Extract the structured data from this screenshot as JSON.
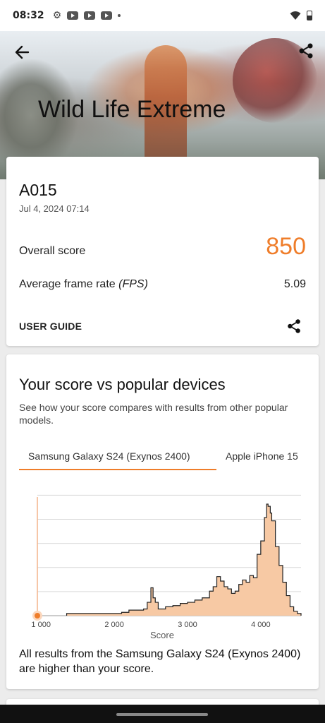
{
  "status_bar": {
    "time": "08:32"
  },
  "header": {
    "title": "Wild Life Extreme"
  },
  "result": {
    "device": "A015",
    "date": "Jul 4, 2024 07:14",
    "overall_label": "Overall score",
    "overall_value": "850",
    "fps_label": "Average frame rate",
    "fps_unit": "(FPS)",
    "fps_value": "5.09",
    "guide_label": "USER GUIDE"
  },
  "comparison": {
    "title": "Your score vs popular devices",
    "description": "See how your score compares with results from other popular models.",
    "tabs": [
      "Samsung Galaxy S24 (Exynos 2400)",
      "Apple iPhone 15"
    ],
    "active_tab": 0,
    "footnote": "All results from the Samsung Galaxy S24 (Exynos 2400) are higher than your score."
  },
  "chart_data": {
    "type": "area",
    "xlabel": "Score",
    "ylabel": "",
    "xlim": [
      950,
      4550
    ],
    "ylim": [
      0,
      1.0
    ],
    "xticks": [
      1000,
      2000,
      3000,
      4000
    ],
    "xtick_labels": [
      "1 000",
      "2 000",
      "3 000",
      "4 000"
    ],
    "grid": true,
    "your_score": 850,
    "x": [
      1350,
      1500,
      1700,
      1900,
      2100,
      2200,
      2300,
      2400,
      2450,
      2500,
      2530,
      2560,
      2600,
      2700,
      2800,
      2900,
      3000,
      3100,
      3200,
      3300,
      3350,
      3400,
      3450,
      3500,
      3550,
      3600,
      3650,
      3700,
      3750,
      3800,
      3850,
      3900,
      3950,
      4000,
      4050,
      4080,
      4100,
      4130,
      4150,
      4200,
      4250,
      4300,
      4350,
      4400,
      4450,
      4500
    ],
    "y": [
      0.02,
      0.02,
      0.02,
      0.02,
      0.03,
      0.05,
      0.05,
      0.06,
      0.12,
      0.25,
      0.16,
      0.12,
      0.06,
      0.08,
      0.09,
      0.11,
      0.12,
      0.14,
      0.16,
      0.22,
      0.26,
      0.35,
      0.31,
      0.26,
      0.24,
      0.2,
      0.22,
      0.28,
      0.32,
      0.3,
      0.36,
      0.34,
      0.55,
      0.67,
      0.88,
      1.0,
      0.98,
      0.92,
      0.85,
      0.62,
      0.45,
      0.3,
      0.18,
      0.08,
      0.04,
      0.02
    ],
    "colors": {
      "fill": "#f7c9a4",
      "line": "#222222",
      "accent": "#ef7d2a",
      "grid": "#d9d9d9"
    }
  }
}
